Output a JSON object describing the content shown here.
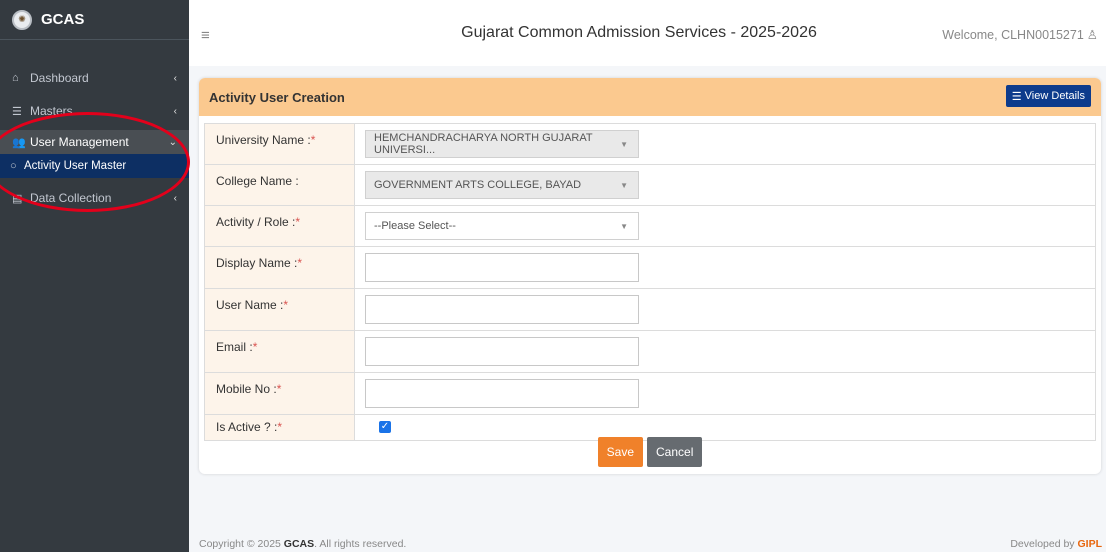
{
  "brand": {
    "name": "GCAS",
    "logo": "university-seal-icon"
  },
  "sidebar": {
    "items": [
      {
        "label": "Dashboard",
        "icon": "home-icon",
        "chevron": "chevron-left-icon"
      },
      {
        "label": "Masters",
        "icon": "list-icon",
        "chevron": "chevron-left-icon"
      },
      {
        "label": "User Management",
        "icon": "users-icon",
        "chevron": "chevron-down-icon"
      },
      {
        "label": "Activity User Master",
        "icon": "circle-icon"
      },
      {
        "label": "Data Collection",
        "icon": "database-icon",
        "chevron": "chevron-left-icon"
      }
    ]
  },
  "topbar": {
    "title": "Gujarat Common Admission Services - 2025-2026",
    "welcome": "Welcome, CLHN0015271"
  },
  "card": {
    "title": "Activity User Creation",
    "view_details": "View Details",
    "header_color": "#fbc98f"
  },
  "form": {
    "university_label": "University Name :",
    "university_value": "HEMCHANDRACHARYA NORTH GUJARAT UNIVERSI...",
    "college_label": "College Name :",
    "college_value": "GOVERNMENT ARTS COLLEGE, BAYAD",
    "activity_label": "Activity / Role :",
    "activity_value": "--Please Select--",
    "display_label": "Display Name :",
    "username_label": "User Name :",
    "email_label": "Email :",
    "mobile_label": "Mobile No :",
    "active_label": "Is Active ? :",
    "is_active": true,
    "required_mark": "*"
  },
  "buttons": {
    "save": "Save",
    "cancel": "Cancel",
    "save_color": "#f0812a",
    "cancel_color": "#666b70"
  },
  "footer": {
    "copyright_prefix": "Copyright © 2025",
    "copyright_brand": "GCAS",
    "copyright_suffix": ". All rights reserved.",
    "developed_prefix": "Developed by",
    "developed_brand": "GIPL"
  }
}
